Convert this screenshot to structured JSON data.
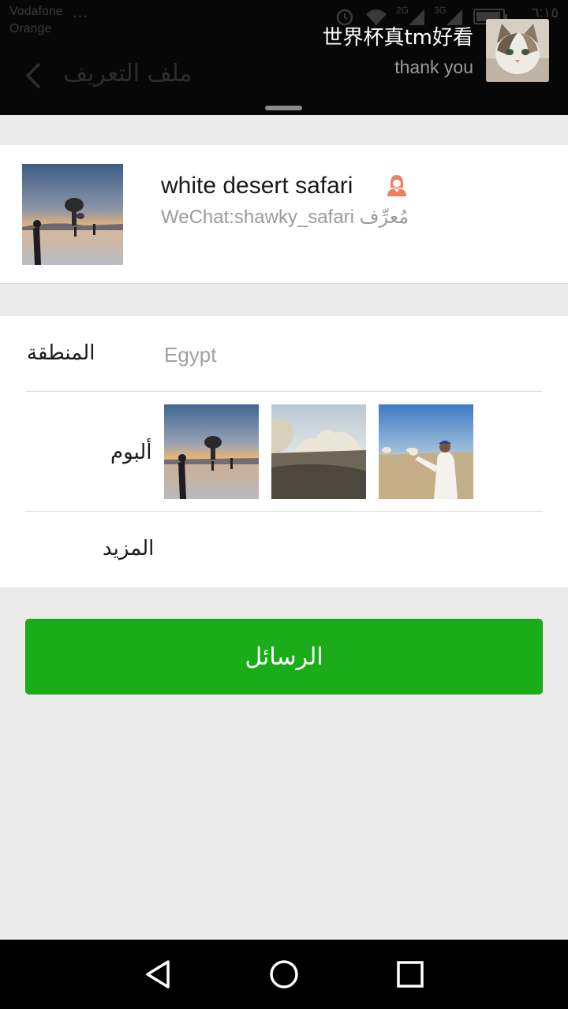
{
  "status_bar": {
    "carrier_line1": "Vodafone",
    "carrier_line2": "Orange",
    "overflow_dots": "...",
    "network_2g": "2G",
    "network_3g": "3G",
    "time": "٦:١٥"
  },
  "app_bar": {
    "title": "ملف التعريف",
    "back_icon": "chevron-left-icon"
  },
  "notification": {
    "title": "世界杯真tm好看",
    "text": "thank you",
    "avatar_icon": "cat-photo"
  },
  "profile": {
    "name": "white desert safari",
    "id_line": "WeChat:shawky_safari مُعرِّف",
    "gender_icon": "female-icon",
    "gender_color": "#f37e5f"
  },
  "details": {
    "region_label": "المنطقة",
    "region_value": "Egypt",
    "album_label": "ألبوم",
    "album_photos": [
      "desert-sunset-photo",
      "white-rock-formation-photo",
      "man-in-desert-photo"
    ],
    "more_label": "المزيد"
  },
  "actions": {
    "messages_label": "الرسائل",
    "accent_color": "#1aad19"
  },
  "nav_bar": {
    "back_icon": "triangle-back-icon",
    "home_icon": "circle-home-icon",
    "recents_icon": "square-recents-icon"
  }
}
